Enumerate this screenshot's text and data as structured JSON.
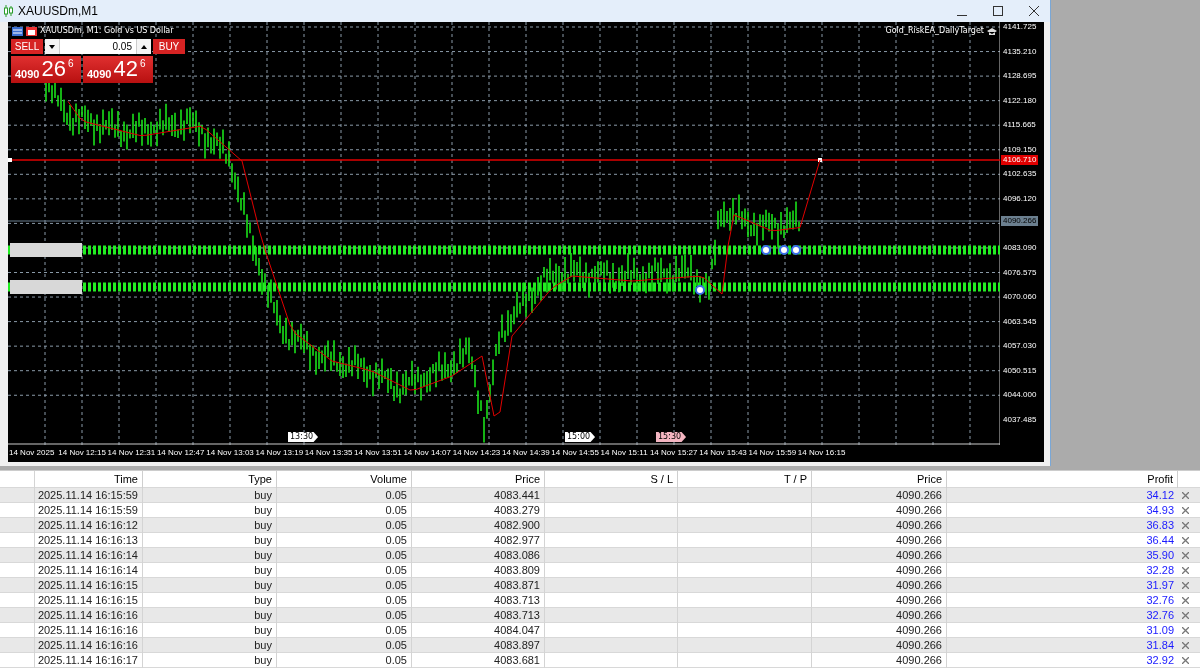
{
  "window": {
    "title": "XAUUSDm,M1"
  },
  "chart": {
    "title": "XAUUSDm, M1:  Gold vs US Dollar",
    "expert": "Gold_RiskEA_DailyTarget",
    "trade_panel": {
      "sell_label": "SELL",
      "buy_label": "BUY",
      "volume": "0.05",
      "sell_price": {
        "prefix": "4090",
        "main": "26",
        "sup": "6"
      },
      "buy_price": {
        "prefix": "4090",
        "main": "42",
        "sup": "6"
      }
    },
    "price_axis": [
      "4141.725",
      "4135.210",
      "4128.695",
      "4122.180",
      "4115.665",
      "4109.150",
      "4102.635",
      "4096.120",
      "4083.090",
      "4076.575",
      "4070.060",
      "4063.545",
      "4057.030",
      "4050.515",
      "4044.000",
      "4037.485"
    ],
    "price_tags": [
      {
        "text": "4106.710",
        "kind": "line"
      },
      {
        "text": "4090.266",
        "kind": "bid"
      }
    ],
    "time_axis": [
      "14 Nov 2025",
      "14 Nov 12:15",
      "14 Nov 12:31",
      "14 Nov 12:47",
      "14 Nov 13:03",
      "14 Nov 13:19",
      "14 Nov 13:35",
      "14 Nov 13:51",
      "14 Nov 14:07",
      "14 Nov 14:23",
      "14 Nov 14:39",
      "14 Nov 14:55",
      "14 Nov 15:11",
      "14 Nov 15:27",
      "14 Nov 15:43",
      "14 Nov 15:59",
      "14 Nov 16:15"
    ],
    "time_markers": [
      {
        "text": "13:30",
        "color": "#ffffff"
      },
      {
        "text": "15:00",
        "color": "#ffffff"
      },
      {
        "text": "15:30",
        "color": "#f4b6c2"
      }
    ]
  },
  "positions": {
    "columns": [
      "Time",
      "Type",
      "Volume",
      "Price",
      "S / L",
      "T / P",
      "Price",
      "Profit"
    ],
    "rows": [
      {
        "time": "2025.11.14 16:15:59",
        "type": "buy",
        "volume": "0.05",
        "price": "4083.441",
        "current": "4090.266",
        "profit": "34.12"
      },
      {
        "time": "2025.11.14 16:15:59",
        "type": "buy",
        "volume": "0.05",
        "price": "4083.279",
        "current": "4090.266",
        "profit": "34.93"
      },
      {
        "time": "2025.11.14 16:16:12",
        "type": "buy",
        "volume": "0.05",
        "price": "4082.900",
        "current": "4090.266",
        "profit": "36.83"
      },
      {
        "time": "2025.11.14 16:16:13",
        "type": "buy",
        "volume": "0.05",
        "price": "4082.977",
        "current": "4090.266",
        "profit": "36.44"
      },
      {
        "time": "2025.11.14 16:16:14",
        "type": "buy",
        "volume": "0.05",
        "price": "4083.086",
        "current": "4090.266",
        "profit": "35.90"
      },
      {
        "time": "2025.11.14 16:16:14",
        "type": "buy",
        "volume": "0.05",
        "price": "4083.809",
        "current": "4090.266",
        "profit": "32.28"
      },
      {
        "time": "2025.11.14 16:16:15",
        "type": "buy",
        "volume": "0.05",
        "price": "4083.871",
        "current": "4090.266",
        "profit": "31.97"
      },
      {
        "time": "2025.11.14 16:16:15",
        "type": "buy",
        "volume": "0.05",
        "price": "4083.713",
        "current": "4090.266",
        "profit": "32.76"
      },
      {
        "time": "2025.11.14 16:16:16",
        "type": "buy",
        "volume": "0.05",
        "price": "4083.713",
        "current": "4090.266",
        "profit": "32.76"
      },
      {
        "time": "2025.11.14 16:16:16",
        "type": "buy",
        "volume": "0.05",
        "price": "4084.047",
        "current": "4090.266",
        "profit": "31.09"
      },
      {
        "time": "2025.11.14 16:16:16",
        "type": "buy",
        "volume": "0.05",
        "price": "4083.897",
        "current": "4090.266",
        "profit": "31.84"
      },
      {
        "time": "2025.11.14 16:16:17",
        "type": "buy",
        "volume": "0.05",
        "price": "4083.681",
        "current": "4090.266",
        "profit": "32.92"
      }
    ]
  }
}
